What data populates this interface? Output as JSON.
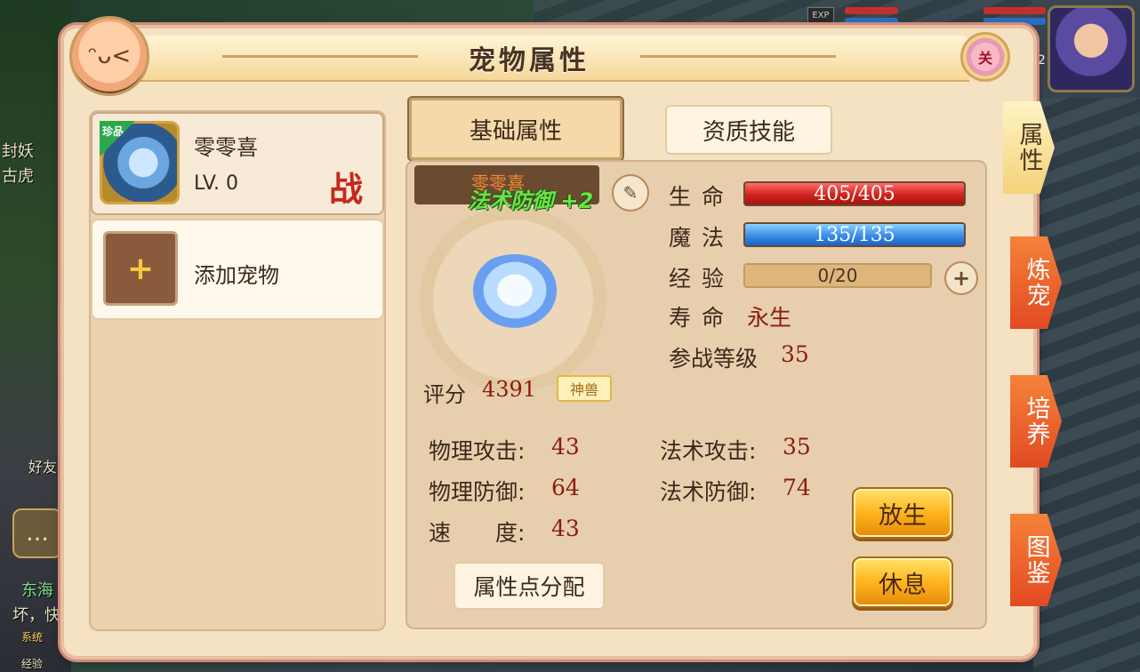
{
  "panel": {
    "title": "宠物属性",
    "close_label": "关"
  },
  "hud": {
    "exp_tag": "EXP",
    "hero_level": "02"
  },
  "background_chat": {
    "lines": [
      "封妖",
      "古虎",
      "好友",
      "东海",
      "坏，快",
      "系统",
      "经验"
    ]
  },
  "pet_list": {
    "pets": [
      {
        "name": "零零喜",
        "level": "LV. 0",
        "rare_tag": "珍品",
        "battle_badge": "战"
      }
    ],
    "add_label": "添加宠物",
    "add_symbol": "+"
  },
  "tabs": {
    "basic": "基础属性",
    "skills": "资质技能"
  },
  "detail": {
    "name": "零零喜",
    "buff": "法术防御 +2",
    "edit_icon": "pencil-icon",
    "score_label": "评分",
    "score_value": "4391",
    "beast_tag": "神兽",
    "hp_label": "生 命",
    "hp_value": "405/405",
    "hp_fraction": 1.0,
    "mp_label": "魔 法",
    "mp_value": "135/135",
    "mp_fraction": 1.0,
    "exp_label": "经 验",
    "exp_value": "0/20",
    "exp_fraction": 0.0,
    "life_label": "寿 命",
    "life_value": "永生",
    "battle_level_label": "参战等级",
    "battle_level_value": "35",
    "stats": {
      "phys_atk_label": "物理攻击:",
      "phys_atk_value": "43",
      "phys_def_label": "物理防御:",
      "phys_def_value": "64",
      "speed_label": "速　　度:",
      "speed_value": "43",
      "magic_atk_label": "法术攻击:",
      "magic_atk_value": "35",
      "magic_def_label": "法术防御:",
      "magic_def_value": "74"
    },
    "alloc_button": "属性点分配",
    "release_button": "放生",
    "rest_button": "休息"
  },
  "side_tabs": [
    {
      "label": "属性",
      "active": true
    },
    {
      "label": "炼宠",
      "active": false
    },
    {
      "label": "培养",
      "active": false
    },
    {
      "label": "图鉴",
      "active": false
    }
  ],
  "colors": {
    "panel_bg": "#f4e2c3",
    "hp_bar": "#d0241e",
    "mp_bar": "#3a8ee8",
    "value_red": "#8a1c12",
    "buff_green": "#6fe04a",
    "button_orange": "#ffb41e",
    "side_tab_orange": "#e24a22"
  }
}
